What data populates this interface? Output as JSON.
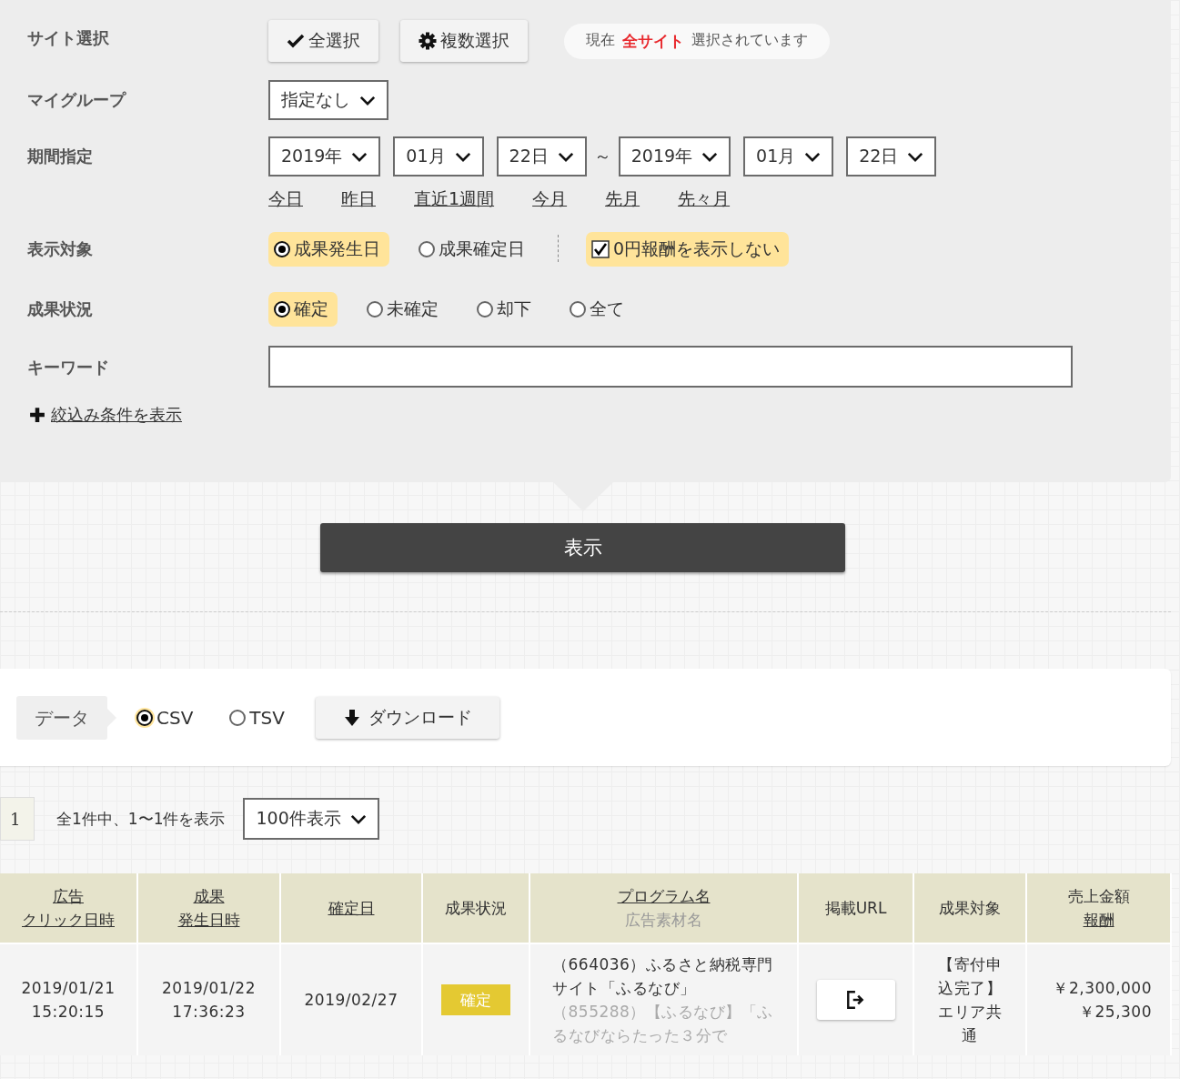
{
  "filters": {
    "site_select": {
      "label": "サイト選択",
      "buttons": [
        {
          "label": "全選択",
          "kind": "select_all"
        },
        {
          "label": "複数選択",
          "kind": "multi_select"
        }
      ],
      "status": {
        "prefix": "現在",
        "highlight": "全サイト",
        "suffix": "選択されています"
      }
    },
    "my_group": {
      "label": "マイグループ",
      "value": "指定なし"
    },
    "period": {
      "label": "期間指定",
      "from": [
        "2019年",
        "01月",
        "22日"
      ],
      "separator": "～",
      "to": [
        "2019年",
        "01月",
        "22日"
      ],
      "shortcuts": [
        "今日",
        "昨日",
        "直近1週間",
        "今月",
        "先月",
        "先々月"
      ]
    },
    "display_target": {
      "label": "表示対象",
      "radios": [
        {
          "label": "成果発生日",
          "selected": true
        },
        {
          "label": "成果確定日",
          "selected": false
        }
      ],
      "checkbox": {
        "label": "0円報酬を表示しない",
        "checked": true
      }
    },
    "result_status": {
      "label": "成果状況",
      "radios": [
        {
          "label": "確定",
          "selected": true
        },
        {
          "label": "未確定",
          "selected": false
        },
        {
          "label": "却下",
          "selected": false
        },
        {
          "label": "全て",
          "selected": false
        }
      ]
    },
    "keyword": {
      "label": "キーワード"
    },
    "more_filters": "絞込み条件を表示"
  },
  "submit_button": "表示",
  "export": {
    "label": "データ",
    "formats": [
      {
        "label": "CSV",
        "selected": true
      },
      {
        "label": "TSV",
        "selected": false
      }
    ],
    "download_button": "ダウンロード"
  },
  "pagination": {
    "pages": [
      {
        "label": "1",
        "selected": true
      }
    ],
    "summary": "全1件中、1〜1件を表示",
    "per_page": "100件表示"
  },
  "table": {
    "columns": [
      {
        "lines": [
          {
            "text": "広告",
            "kind": "link"
          },
          {
            "text": "クリック日時",
            "kind": "link"
          }
        ]
      },
      {
        "lines": [
          {
            "text": "成果",
            "kind": "link"
          },
          {
            "text": "発生日時",
            "kind": "link"
          }
        ]
      },
      {
        "lines": [
          {
            "text": "確定日",
            "kind": "link"
          }
        ]
      },
      {
        "lines": [
          {
            "text": "成果状況",
            "kind": "plain"
          }
        ]
      },
      {
        "lines": [
          {
            "text": "プログラム名",
            "kind": "link"
          },
          {
            "text": "広告素材名",
            "kind": "sub"
          }
        ]
      },
      {
        "lines": [
          {
            "text": "掲載URL",
            "kind": "plain"
          }
        ]
      },
      {
        "lines": [
          {
            "text": "成果対象",
            "kind": "plain"
          }
        ]
      },
      {
        "lines": [
          {
            "text": "売上金額",
            "kind": "plain"
          },
          {
            "text": "報酬",
            "kind": "link"
          }
        ]
      }
    ],
    "rows": [
      {
        "click_date": [
          "2019/01/21",
          "15:20:15"
        ],
        "occur_date": [
          "2019/01/22",
          "17:36:23"
        ],
        "confirm_date": "2019/02/27",
        "status": "確定",
        "program": "（664036）ふるさと納税専門サイト「ふるなび」",
        "material": "（855288）【ふるなび】「ふるなびならたった３分で",
        "target": "【寄付申込完了】エリア共通",
        "amounts": [
          "￥2,300,000",
          "￥25,300"
        ]
      }
    ]
  }
}
